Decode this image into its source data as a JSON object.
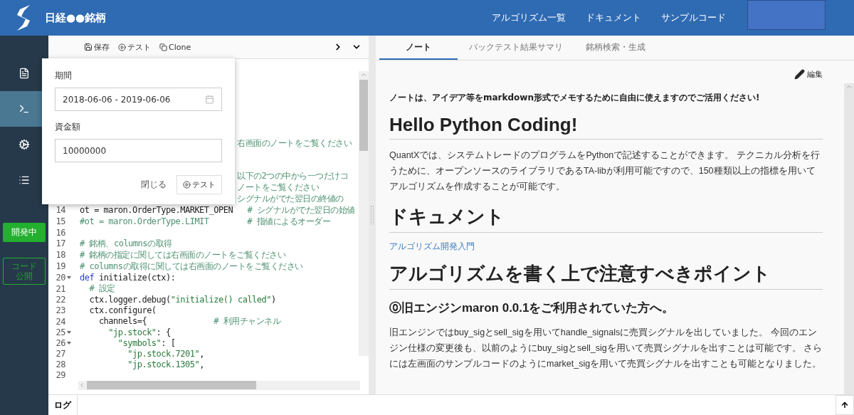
{
  "header": {
    "title": "日経●●銘柄",
    "nav": [
      "アルゴリズム一覧",
      "ドキュメント",
      "サンプルコード"
    ]
  },
  "sidebar": {
    "items": [
      {
        "kind": "document",
        "selected": false
      },
      {
        "kind": "terminal",
        "selected": true
      },
      {
        "kind": "gears",
        "selected": false
      },
      {
        "kind": "list",
        "selected": false
      }
    ],
    "status": "開発中",
    "publish": "コード公開"
  },
  "toolbar": {
    "buttons": [
      {
        "kind": "save",
        "label": "保存"
      },
      {
        "kind": "play",
        "label": "テスト"
      },
      {
        "kind": "clone",
        "label": "Clone"
      }
    ]
  },
  "popover": {
    "period_label": "期間",
    "period": "2018-06-06 - 2019-06-06",
    "capital_label": "資金額",
    "capital": "10000000",
    "close": "閉じる",
    "run": "テスト"
  },
  "covered_code": [
    "右画面のノートをご覧ください",
    "以下の2つの中から一つだけコ",
    "ノートをご覧ください",
    "シグナルがでた翌日の終値の"
  ],
  "code": [
    {
      "number": "14",
      "segments": [
        {
          "t": "ot = maron.OrderType.MARKET_OPEN   ",
          "kind": "plain"
        },
        {
          "t": "# シグナルがでた翌日の始値",
          "kind": "comment"
        }
      ]
    },
    {
      "number": "15",
      "segments": [
        {
          "t": "#ot = maron.OrderType.LIMIT        # 指値によるオーダー",
          "kind": "comment"
        }
      ]
    },
    {
      "number": "16"
    },
    {
      "number": "17",
      "segments": [
        {
          "t": "# 銘柄、columnsの取得",
          "kind": "comment"
        }
      ]
    },
    {
      "number": "18",
      "segments": [
        {
          "t": "# 銘柄の指定に関しては右画面のノートをご覧ください",
          "kind": "comment"
        }
      ]
    },
    {
      "number": "19",
      "segments": [
        {
          "t": "# columnsの取得に関しては右画面のノートをご覧ください",
          "kind": "comment"
        }
      ]
    },
    {
      "number": "20",
      "fold": true,
      "segments": [
        {
          "t": "def",
          "kind": "keyword"
        },
        {
          "t": " initialize(ctx):",
          "kind": "plain"
        }
      ]
    },
    {
      "number": "21",
      "segments": [
        {
          "t": "  # 設定",
          "kind": "comment"
        }
      ]
    },
    {
      "number": "22",
      "segments": [
        {
          "t": "  ctx.logger.debug(",
          "kind": "plain"
        },
        {
          "t": "\"initialize() called\"",
          "kind": "string"
        },
        {
          "t": ")",
          "kind": "plain"
        }
      ]
    },
    {
      "number": "23",
      "segments": [
        {
          "t": "  ctx.configure(",
          "kind": "plain"
        }
      ]
    },
    {
      "number": "24",
      "segments": [
        {
          "t": "    channels={              ",
          "kind": "plain"
        },
        {
          "t": "# 利用チャンネル",
          "kind": "comment"
        }
      ]
    },
    {
      "number": "25",
      "fold": true,
      "segments": [
        {
          "t": "      \"jp.stock\"",
          "kind": "string"
        },
        {
          "t": ": {",
          "kind": "plain"
        }
      ]
    },
    {
      "number": "26",
      "fold": true,
      "segments": [
        {
          "t": "        \"symbols\"",
          "kind": "string"
        },
        {
          "t": ": [",
          "kind": "plain"
        }
      ]
    },
    {
      "number": "27",
      "segments": [
        {
          "t": "          \"jp.stock.7201\"",
          "kind": "string"
        },
        {
          "t": ",",
          "kind": "plain"
        }
      ]
    },
    {
      "number": "28",
      "segments": [
        {
          "t": "          \"jp.stock.1305\"",
          "kind": "string"
        },
        {
          "t": ",",
          "kind": "plain"
        }
      ]
    },
    {
      "number": "29"
    }
  ],
  "log_label": "ログ",
  "tabs": [
    {
      "label": "ノート",
      "selected": true
    },
    {
      "label": "バックテスト結果サマリ",
      "selected": false
    },
    {
      "label": "銘柄検索・生成",
      "selected": false
    }
  ],
  "edit": "編集",
  "note": [
    {
      "kind": "lead",
      "text": "ノートは、アイデア等をmarkdown形式でメモするために自由に使えますのでご活用ください!"
    },
    {
      "kind": "h1",
      "text": "Hello Python Coding!"
    },
    {
      "kind": "p",
      "text": "QuantXでは、システムトレードのプログラムをPythonで記述することができます。 テクニカル分析を行うために、オープンソースのライブラリであるTA-libが利用可能ですので、150種類以上の指標を用いてアルゴリズムを作成することが可能です。"
    },
    {
      "kind": "h1",
      "text": "ドキュメント"
    },
    {
      "kind": "link",
      "text": "アルゴリズム開発入門"
    },
    {
      "kind": "h1",
      "text": "アルゴリズムを書く上で注意すべきポイント"
    },
    {
      "kind": "h3",
      "text": "⓪旧エンジンmaron 0.0.1をご利用されていた方へ。"
    },
    {
      "kind": "p",
      "text": "旧エンジンではbuy_sigとsell_sigを用いてhandle_signalsに売買シグナルを出していました。 今回のエンジン仕様の変更後も、以前のようにbuy_sigとsell_sigを用いて売買シグナルを出すことは可能です。 さらには左画面のサンプルコードのようにmarket_sigを用いて売買シグナルを出すことも可能となりました。"
    }
  ]
}
